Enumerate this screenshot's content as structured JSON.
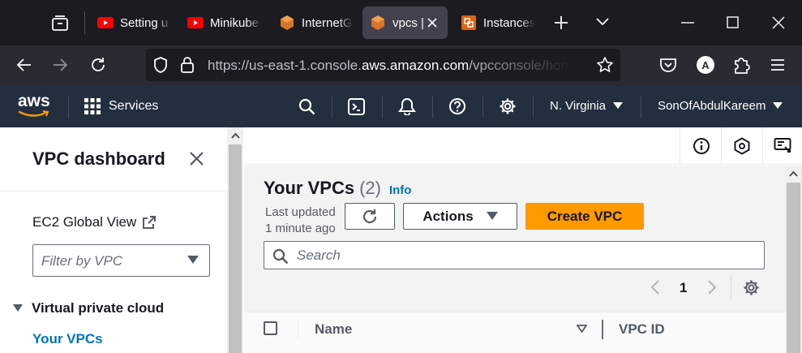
{
  "browser": {
    "tabs": [
      {
        "label": "Setting u",
        "icon": "youtube-icon"
      },
      {
        "label": "Minikube",
        "icon": "youtube-icon"
      },
      {
        "label": "InternetG",
        "icon": "aws-vpc-icon"
      },
      {
        "label": "vpcs |",
        "icon": "aws-vpc-icon",
        "active": true
      },
      {
        "label": "Instances",
        "icon": "aws-ec2-icon"
      }
    ],
    "url_prefix": "https://us-east-1.console.",
    "url_domain": "aws.amazon.com",
    "url_suffix": "/vpcconsole/home",
    "account_initial": "A"
  },
  "aws_header": {
    "logo_text": "aws",
    "services_label": "Services",
    "region_label": "N. Virginia",
    "user_label": "SonOfAbdulKareem"
  },
  "sidebar": {
    "title": "VPC dashboard",
    "global_view_label": "EC2 Global View",
    "filter_placeholder": "Filter by VPC",
    "section_label": "Virtual private cloud",
    "active_item_label": "Your VPCs"
  },
  "main": {
    "heading": "Your VPCs",
    "count": "(2)",
    "info_label": "Info",
    "last_updated_line1": "Last updated",
    "last_updated_line2": "1 minute ago",
    "actions_label": "Actions",
    "create_label": "Create VPC",
    "search_placeholder": "Search",
    "page_number": "1",
    "columns": [
      "Name",
      "VPC ID"
    ]
  },
  "colors": {
    "aws_header_bg": "#232f3e",
    "primary_button": "#ff9900",
    "link_blue": "#0073bb",
    "browser_dark": "#1c1b22"
  }
}
